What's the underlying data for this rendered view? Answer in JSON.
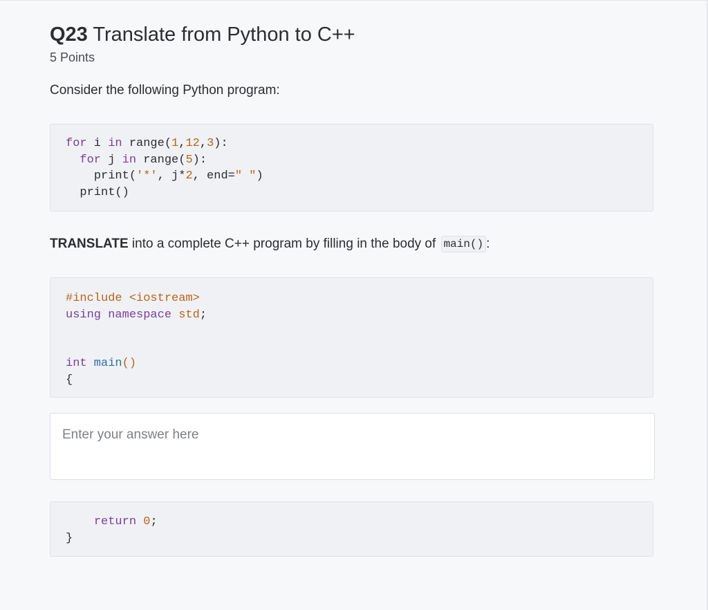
{
  "question": {
    "number": "Q23",
    "title": "Translate from Python to C++",
    "points": "5 Points",
    "prompt": "Consider the following Python program:"
  },
  "python_code": {
    "line1": {
      "kw1": "for",
      "var": " i ",
      "kw2": "in",
      "call": " range(",
      "n1": "1",
      "c1": ",",
      "n2": "12",
      "c2": ",",
      "n3": "3",
      "end": "):"
    },
    "line2": {
      "indent": "  ",
      "kw1": "for",
      "var": " j ",
      "kw2": "in",
      "call": " range(",
      "n1": "5",
      "end": "):"
    },
    "line3": {
      "indent": "    ",
      "pre": "print(",
      "str1": "'*'",
      "mid": ", j*",
      "n1": "2",
      "mid2": ", end=",
      "str2": "\" \"",
      "end": ")"
    },
    "line4": {
      "indent": "  ",
      "text": "print()"
    }
  },
  "instruction": {
    "bold": "TRANSLATE",
    "text": " into a complete C++ program by filling in the body of ",
    "code": "main()",
    "end": ":"
  },
  "cpp_head": {
    "include_directive": "#include <iostream>",
    "using_kw": "using namespace",
    "using_ns": " std",
    "using_end": ";",
    "int_kw": "int",
    "main_fn": " main",
    "main_parens": "()",
    "open_brace": "{"
  },
  "answer": {
    "placeholder": "Enter your answer here"
  },
  "cpp_tail": {
    "indent": "    ",
    "return_kw": "return",
    "space": " ",
    "return_val": "0",
    "semi": ";",
    "close_brace": "}"
  },
  "colors": {
    "keyword": "#7a3e9d",
    "number": "#b8651b",
    "function": "#2e6fa3",
    "code_bg": "#f0f1f4",
    "page_bg": "#f7f8fa"
  }
}
